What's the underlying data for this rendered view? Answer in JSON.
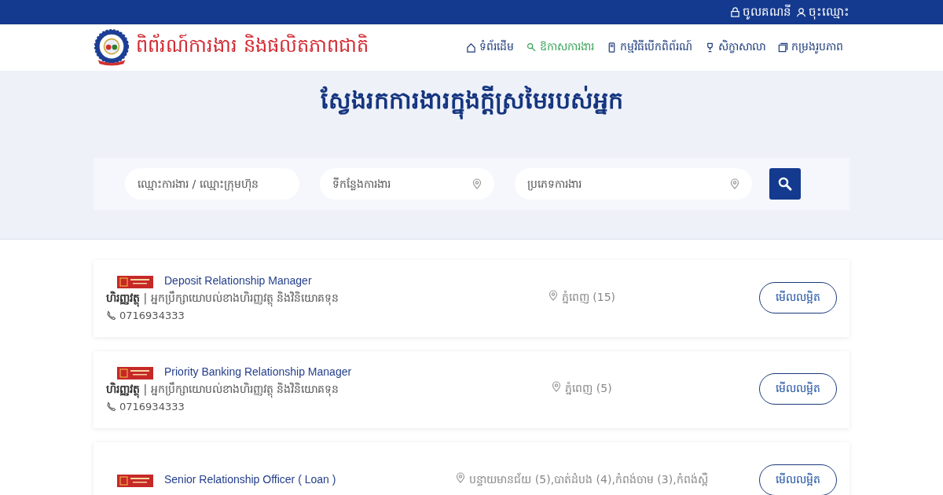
{
  "top_bar": {
    "links": [
      {
        "label": "ចូលគណនី"
      },
      {
        "label": "ចុះឈ្មោះ"
      }
    ]
  },
  "header": {
    "site_title": "ពិព័រណ៍ការងារ និងផលិតភាពជាតិ",
    "nav": [
      {
        "label": "ទំព័រដើម",
        "selected": false
      },
      {
        "label": "ឱកាសការងារ",
        "selected": true
      },
      {
        "label": "កម្មវិធីបើកពិព័រណ៍",
        "selected": false
      },
      {
        "label": "សិក្ខាសាលា",
        "selected": false
      },
      {
        "label": "កម្រងរូបភាព",
        "selected": false
      }
    ]
  },
  "hero": {
    "title": "ស្វែងរកការងារក្នុងក្តីស្រមៃរបស់អ្នក",
    "search": {
      "fields": [
        {
          "kind": "text",
          "placeholder": "ឈ្មោះការងារ / ឈ្មោះក្រុមហ៊ុន"
        },
        {
          "kind": "location",
          "placeholder": "ទីកន្លែងការងារ"
        },
        {
          "kind": "location",
          "placeholder": "ប្រភេទការងារ"
        }
      ]
    }
  },
  "jobs": [
    {
      "title": "Deposit Relationship Manager",
      "category": "**ហិរញ្ញវត្ថុ** | អ្នកប្រឹក្សាយោបល់ខាងហិរញ្ញវត្ថុ និងវិនិយោគទុន",
      "phone": "0716934333",
      "location": "ភ្នំពេញ (15)",
      "button": "មើលលម្អិត"
    },
    {
      "title": "Priority Banking Relationship Manager",
      "category": "**ហិរញ្ញវត្ថុ** | អ្នកប្រឹក្សាយោបល់ខាងហិរញ្ញវត្ថុ និងវិនិយោគទុន",
      "phone": "0716934333",
      "location": "ភ្នំពេញ (5)",
      "button": "មើលលម្អិត"
    },
    {
      "title": "Senior Relationship Officer ( Loan )",
      "location": "បន្ទាយមានជ័យ (5),បាត់ដំបង (4),កំពង់ចាម (3),កំពង់ស្ពឺ",
      "button": "មើលលម្អិត"
    }
  ]
}
